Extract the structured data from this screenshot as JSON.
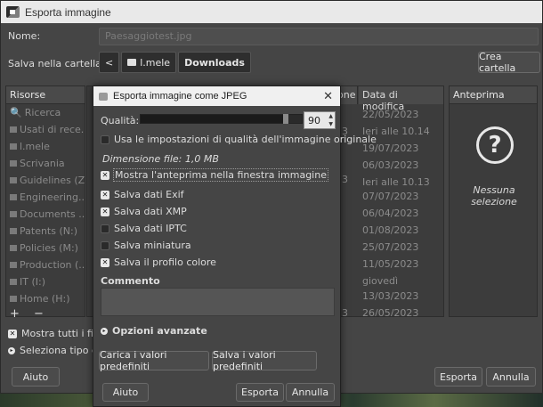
{
  "main": {
    "title": "Esporta immagine",
    "name_label": "Nome:",
    "name_value": "Paesaggiotest.jpg",
    "folder_label": "Salva nella cartella:",
    "crumbs": [
      "<",
      "l.mele",
      "Downloads"
    ],
    "create_folder": "Crea cartella",
    "places_header": "Risorse",
    "places": [
      "Ricerca",
      "Usati di rece...",
      "l.mele",
      "Scrivania",
      "Guidelines (Z:)",
      "Engineering...",
      "Documents ...",
      "Patents (N:)",
      "Policies (M:)",
      "Production (...",
      "IT (I:)",
      "Home (H:)"
    ],
    "add_remove": "+ −",
    "size_header": "one",
    "date_header": "Data di modifica",
    "dates": [
      "22/05/2023",
      "Ieri alle 10.14",
      "19/07/2023",
      "06/03/2023",
      "Ieri alle 10.13",
      "07/07/2023",
      "06/04/2023",
      "01/08/2023",
      "25/07/2023",
      "11/05/2023",
      "giovedì",
      "13/03/2023",
      "26/05/2023"
    ],
    "sizes": [
      "3",
      "3",
      "3"
    ],
    "preview_header": "Anteprima",
    "preview_icon": "?",
    "preview_text": "Nessuna selezione",
    "show_all": "Mostra tutti i file",
    "file_type": "Seleziona tipo di f",
    "help": "Aiuto",
    "export": "Esporta",
    "cancel": "Annulla"
  },
  "jpeg": {
    "title": "Esporta immagine come JPEG",
    "close": "✕",
    "quality_label": "Qualità:",
    "quality_value": 90,
    "quality_display": "90",
    "use_original": "Usa le impostazioni di qualità dell'immagine originale",
    "file_size": "Dimensione file: 1,0 MB",
    "preview_in_window": "Mostra l'anteprima nella finestra immagine",
    "exif": "Salva dati Exif",
    "xmp": "Salva dati XMP",
    "iptc": "Salva dati IPTC",
    "thumbnail": "Salva miniatura",
    "color_profile": "Salva il profilo colore",
    "comment_label": "Commento",
    "advanced": "Opzioni avanzate",
    "load_defaults": "Carica i valori predefiniti",
    "save_defaults": "Salva i valori predefiniti",
    "help": "Aiuto",
    "export": "Esporta",
    "cancel": "Annulla"
  },
  "colors": {
    "dialog_bg": "#454545",
    "titlebar": "#e9e9e9",
    "pane_bg": "#3c3c3c"
  }
}
